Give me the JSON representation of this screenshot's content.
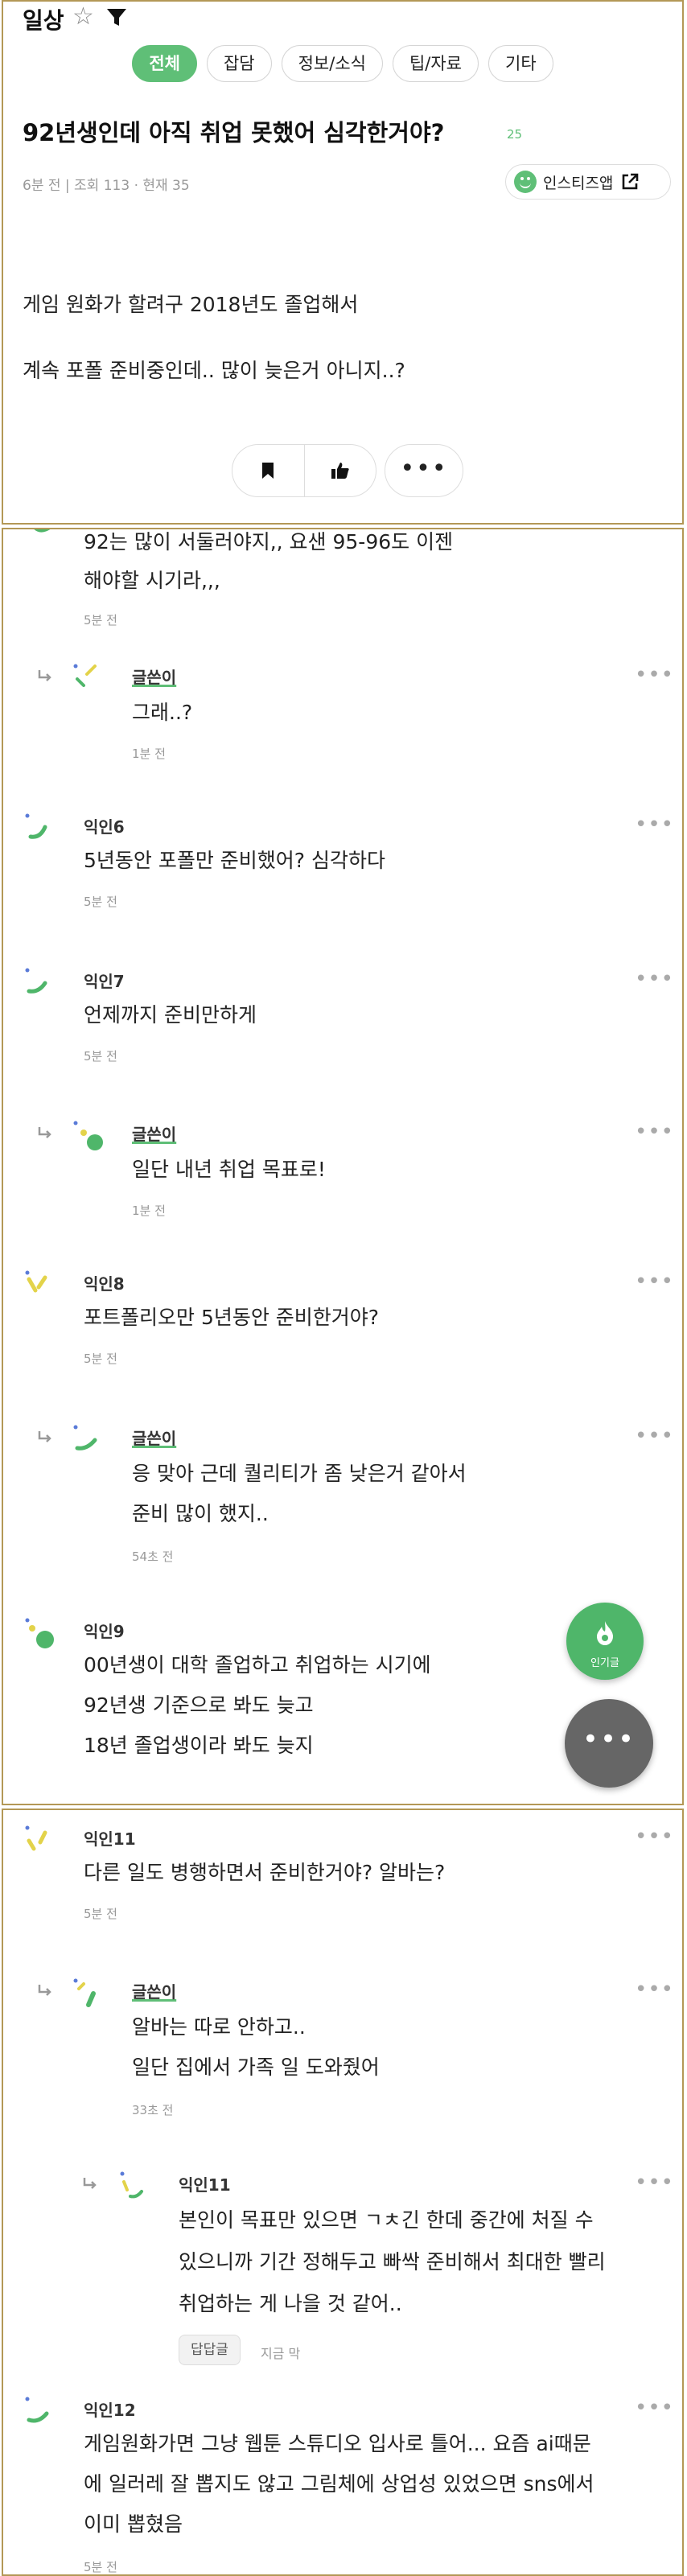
{
  "header": {
    "board": "일상",
    "icons": [
      "star-outline-icon",
      "filter-icon"
    ]
  },
  "tabs": [
    {
      "label": "전체",
      "active": true
    },
    {
      "label": "잡담",
      "active": false
    },
    {
      "label": "정보/소식",
      "active": false
    },
    {
      "label": "팁/자료",
      "active": false
    },
    {
      "label": "기타",
      "active": false
    }
  ],
  "post": {
    "title": "92년생인데 아직 취업 못했어 심각한거야?",
    "comment_count": "25",
    "meta": "6분 전  |  조회 113 · 현재 35",
    "app_link": "인스티즈앱",
    "body": [
      "게임 원화가 할려구 2018년도 졸업해서",
      "계속 포폴 준비중인데.. 많이 늦은거 아니지..?"
    ]
  },
  "comments_panel2": [
    {
      "author": "",
      "lines": [
        "92는 많이 서둘러야지,, 요샌 95-96도 이젠",
        "해야할 시기라,,,"
      ],
      "time": "5분 전"
    },
    {
      "author": "글쓴이",
      "reply": true,
      "lines": [
        "그래..?"
      ],
      "time": "1분 전"
    },
    {
      "author": "익인6",
      "lines": [
        "5년동안 포폴만 준비했어? 심각하다"
      ],
      "time": "5분 전"
    },
    {
      "author": "익인7",
      "lines": [
        "언제까지 준비만하게"
      ],
      "time": "5분 전"
    },
    {
      "author": "글쓴이",
      "reply": true,
      "lines": [
        "일단 내년 취업 목표로!"
      ],
      "time": "1분 전"
    },
    {
      "author": "익인8",
      "lines": [
        "포트폴리오만 5년동안 준비한거야?"
      ],
      "time": "5분 전"
    },
    {
      "author": "글쓴이",
      "reply": true,
      "lines": [
        "응 맞아 근데 퀄리티가 좀 낮은거 같아서",
        "준비 많이 했지.."
      ],
      "time": "54초 전"
    },
    {
      "author": "익인9",
      "lines": [
        "00년생이 대학 졸업하고 취업하는 시기에",
        "92년생 기준으로 봐도 늦고",
        "18년 졸업생이라 봐도 늦지"
      ],
      "time": ""
    }
  ],
  "comments_panel3": [
    {
      "author": "익인11",
      "lines": [
        "다른 일도 병행하면서 준비한거야? 알바는?"
      ],
      "time": "5분 전"
    },
    {
      "author": "글쓴이",
      "reply": true,
      "lines": [
        "알바는 따로 안하고..",
        "일단 집에서 가족 일 도와줬어"
      ],
      "time": "33초 전"
    },
    {
      "author": "익인11",
      "reply": true,
      "lines": [
        "본인이 목표만 있으면 ㄱㅊ긴 한데 중간에 처질 수",
        "있으니까 기간 정해두고 빠싹 준비해서 최대한 빨리",
        "취업하는 게 나을 것 같어.."
      ],
      "reply_label": "답답글",
      "time": "지금 막"
    },
    {
      "author": "익인12",
      "lines": [
        "게임원화가면 그냥 웹툰 스튜디오 입사로 틀어... 요즘 ai때문",
        "에 일러레 잘 뽑지도 않고 그림체에 상업성 있었으면 sns에서",
        "이미 뽑혔음"
      ],
      "time": "5분 전"
    }
  ],
  "floating": {
    "popular_label": "인기글",
    "more": "•••"
  },
  "ui": {
    "more_dots": "•••",
    "accent": "#5fbf77",
    "panel_border": "#b39856"
  }
}
